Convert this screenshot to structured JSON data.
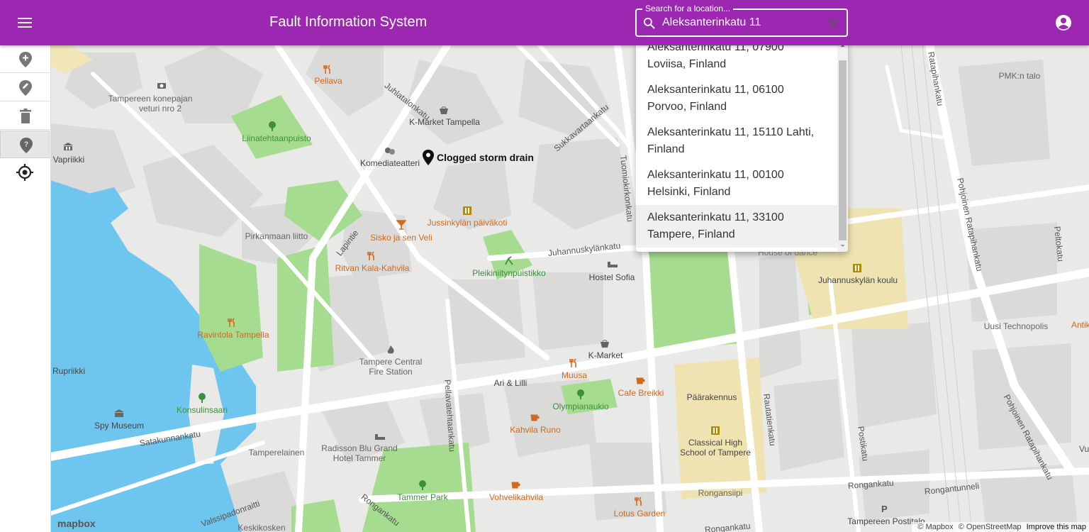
{
  "header": {
    "title": "Fault Information System",
    "color": "#9c27b0"
  },
  "search": {
    "label": "Search for a location...",
    "value": "Aleksanterinkatu 11",
    "icon": "search-icon",
    "clear_icon": "close-icon"
  },
  "results": [
    {
      "line1": "Aleksanterinkatu 11, 07900",
      "line2": "Loviisa, Finland"
    },
    {
      "line1": "Aleksanterinkatu 11, 06100",
      "line2": "Porvoo, Finland"
    },
    {
      "line1": "Aleksanterinkatu 11, 15110 Lahti,",
      "line2": "Finland"
    },
    {
      "line1": "Aleksanterinkatu 11, 00100",
      "line2": "Helsinki, Finland"
    },
    {
      "line1": "Aleksanterinkatu 11, 33100",
      "line2": "Tampere, Finland"
    }
  ],
  "toolbar": {
    "tools": [
      "add-marker-icon",
      "edit-marker-icon",
      "delete-icon",
      "help-marker-icon"
    ],
    "locate": "crosshair-icon"
  },
  "map": {
    "fault_marker": "Clogged storm drain",
    "places": {
      "pellava": "Pellava",
      "konepaja": "Tampereen konepajan",
      "konepaja2": "veturi nro 2",
      "kmarket_tampella": "K-Market Tampella",
      "liinatehtaanpuisto": "Liinatehtaanpuisto",
      "vapriikki": "Vapriikki",
      "komediateatteri": "Komediateatteri",
      "pirkanmaan_liitto": "Pirkanmaan liitto",
      "sisko": "Sisko ja sen Veli",
      "jussinkylan": "Jussinkylän päiväkoti",
      "ritvan": "Ritvan Kala-Kahvila",
      "pleikiniitty": "Pleikiniitynpuistikko",
      "hostel_sofia": "Hostel Sofia",
      "ravintola_tampella": "Ravintola Tampella",
      "kmarket": "K-Market",
      "fire_station": "Tampere Central",
      "fire_station2": "Fire Station",
      "rupriikki": "Rupriikki",
      "musa": "Muusa",
      "ari_lilli": "Ari & Lilli",
      "cafe_breikki": "Cafe Breikki",
      "olympianaukio": "Olympianaukio",
      "konsulinsaari": "Konsulinsaari",
      "spy_museum": "Spy Museum",
      "kahvila_runo": "Kahvila Runo",
      "paarakennus": "Päärakennus",
      "classical": "Classical High",
      "classical2": "School of Tampere",
      "tamperelainen": "Tamperelainen",
      "radisson": "Radisson Blu Grand",
      "radisson2": "Hotel Tammer",
      "tammer_park": "Tammer Park",
      "vohvelikahvila": "Vohvelikahvila",
      "rongansiipi": "Rongansiipi",
      "lotus": "Lotus Garden",
      "keskikosken": "Keskikosken",
      "pmk": "PMK:n talo",
      "juhannuskylan_koulu": "Juhannuskylän koulu",
      "uusi_technopolis": "Uusi Technopolis",
      "antik": "Antik",
      "tampereen_postitalo": "Tampereen Postitalo",
      "house_of_dance": "House of dance"
    },
    "streets": {
      "juhlatalonkatu": "Juhlatalonkatu",
      "sukkavartaankatu": "Sukkavartaankatu",
      "tuomiokirkonkatu": "Tuomiokirkonkatu",
      "ratapihankatu": "Ratapihankatu",
      "pohjoinen_ratapihankatu": "Pohjoinen Ratapihankatu",
      "lapintie": "Lapintie",
      "juhannuskylankatu": "Juhannuskylänkatu",
      "pellavatehtaankatu": "Pellavatehtaankatu",
      "satakunnankatu": "Satakunnankatu",
      "rautatienkatu": "Rautatienkatu",
      "postikatu": "Postikatu",
      "pohjoinen_ratapihankatu2": "Pohjoinen Ratapihankatu",
      "ronganktu": "Rongankatu",
      "ronganktu2": "Rongankatu",
      "ronganktu3": "Rongankatu",
      "rongantunneli": "Rongantunneli",
      "valssipadonraitti": "Valssipadonraitti",
      "peltokatu": "Peltokatu",
      "vu": "Vu"
    },
    "attribution": {
      "mapbox": "© Mapbox",
      "osm": "© OpenStreetMap",
      "improve": "Improve this map",
      "logo": "mapbox"
    }
  }
}
